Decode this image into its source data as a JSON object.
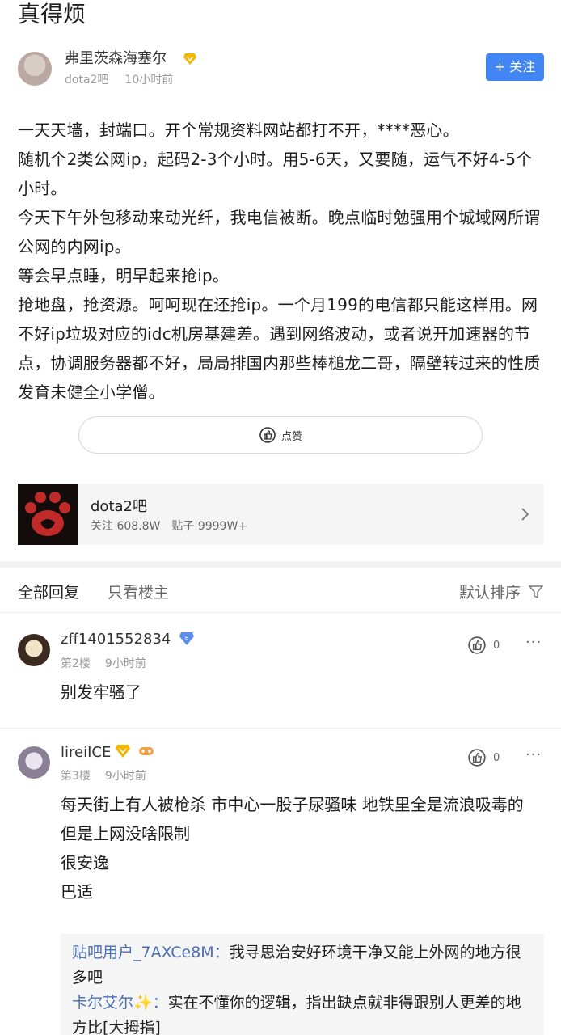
{
  "post": {
    "title": "真得烦",
    "author": {
      "name": "弗里茨森海塞尔",
      "forum": "dota2吧",
      "time": "10小时前",
      "badge_icon": "diamond-vip-icon"
    },
    "follow_label": "+ 关注",
    "body": [
      "一天天墙，封端口。开个常规资料网站都打不开，****恶心。",
      "随机个2类公网ip，起码2-3个小时。用5-6天，又要随，运气不好4-5个小时。",
      "今天下午外包移动来动光纤，我电信被断。晚点临时勉强用个城域网所谓公网的内网ip。",
      "等会早点睡，明早起来抢ip。",
      "抢地盘，抢资源。呵呵现在还抢ip。一个月199的电信都只能这样用。网不好ip垃圾对应的idc机房基建差。遇到网络波动，或者说开加速器的节点，协调服务器都不好，局局排国内那些棒槌龙二哥，隔壁转过来的性质发育未健全小学僧。"
    ],
    "like_label": "点赞"
  },
  "forum": {
    "name": "dota2吧",
    "followers": "关注 608.8W",
    "posts": "贴子 9999W+"
  },
  "tabs": {
    "all": "全部回复",
    "op_only": "只看楼主",
    "sort": "默认排序"
  },
  "replies": [
    {
      "user": "zff1401552834",
      "floor": "第2楼",
      "time": "9小时前",
      "likes": "0",
      "more": "···",
      "text": [
        "别发牢骚了"
      ]
    },
    {
      "user": "lireiICE",
      "floor": "第3楼",
      "time": "9小时前",
      "likes": "0",
      "more": "···",
      "text": [
        "每天街上有人被枪杀 市中心一股子尿骚味 地铁里全是流浪吸毒的",
        "但是上网没啥限制",
        "很安逸",
        "巴适"
      ],
      "sub_replies": [
        {
          "user": "贴吧用户_7AXCe8M：",
          "text": "我寻思治安好环境干净又能上外网的地方很多吧"
        },
        {
          "user": "卡尔艾尔✨：",
          "text": "实在不懂你的逻辑，指出缺点就非得跟别人更差的地方比[大拇指]"
        }
      ]
    }
  ],
  "colors": {
    "accent": "#4285f4",
    "sub_user": "#4a6fb3",
    "badge_gold": "#f2b705"
  }
}
